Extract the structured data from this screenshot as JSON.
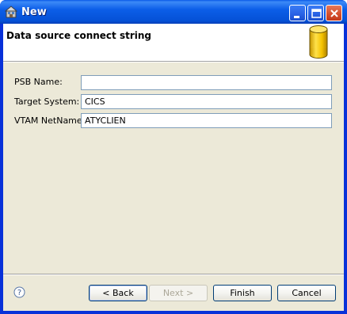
{
  "window": {
    "title": "New"
  },
  "header": {
    "title": "Data source connect string",
    "icon": "database-cylinder-icon"
  },
  "form": {
    "psb_label": "PSB Name:",
    "psb_value": "",
    "target_label": "Target System:",
    "target_value": "CICS",
    "vtam_label": "VTAM NetName:",
    "vtam_value": "ATYCLIEN"
  },
  "buttons": {
    "back": "< Back",
    "next": "Next >",
    "finish": "Finish",
    "cancel": "Cancel"
  },
  "colors": {
    "titlebar": "#0551d6",
    "dialog_bg": "#ece9d8",
    "database_icon": "#f5c200"
  }
}
